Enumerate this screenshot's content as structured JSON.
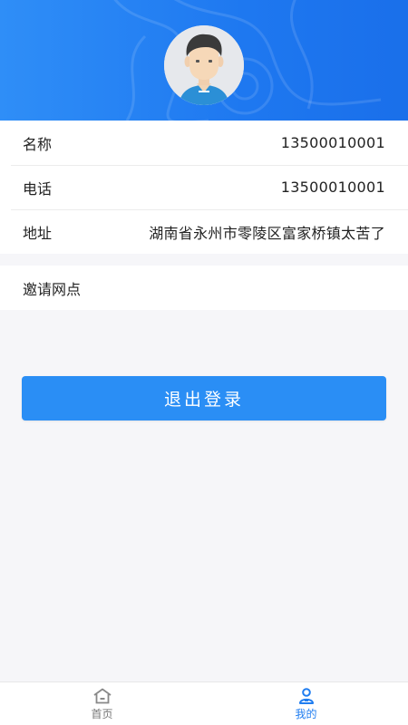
{
  "profile": {
    "rows": [
      {
        "label": "名称",
        "value": "13500010001"
      },
      {
        "label": "电话",
        "value": "13500010001"
      },
      {
        "label": "地址",
        "value": "湖南省永州市零陵区富家桥镇太苦了"
      }
    ],
    "invite_label": "邀请网点"
  },
  "actions": {
    "logout_label": "退出登录"
  },
  "tabbar": {
    "items": [
      {
        "label": "首页",
        "icon": "home-icon",
        "active": false
      },
      {
        "label": "我的",
        "icon": "user-icon",
        "active": true
      }
    ]
  },
  "colors": {
    "header_blue": "#1e78f0",
    "button_blue": "#2a8ef5",
    "active_tab": "#1f7df0",
    "background": "#f6f6f9"
  }
}
